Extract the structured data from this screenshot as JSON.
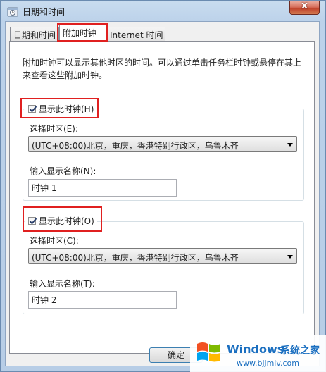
{
  "window": {
    "title": "日期和时间",
    "close_glyph": "x"
  },
  "tabs": [
    {
      "label": "日期和时间"
    },
    {
      "label": "附加时钟",
      "active": true
    },
    {
      "label": "Internet 时间"
    }
  ],
  "description": "附加时钟可以显示其他时区的时间。可以通过单击任务栏时钟或悬停在其上来查看这些附加时钟。",
  "clock1": {
    "checkbox_label": "显示此时钟(H)",
    "checked": true,
    "timezone_label": "选择时区(E):",
    "timezone_value": "(UTC+08:00)北京，重庆，香港特别行政区，乌鲁木齐",
    "name_label": "输入显示名称(N):",
    "name_value": "时钟 1"
  },
  "clock2": {
    "checkbox_label": "显示此时钟(O)",
    "checked": true,
    "timezone_label": "选择时区(C):",
    "timezone_value": "(UTC+08:00)北京，重庆，香港特别行政区，乌鲁木齐",
    "name_label": "输入显示名称(T):",
    "name_value": "时钟 2"
  },
  "buttons": {
    "ok": "确定"
  },
  "watermark": {
    "brand": "Windows",
    "cn": "系统之家",
    "url": "www.bjjmlv.com"
  },
  "colors": {
    "highlight": "#e02020",
    "watermark_blue": "#1b6fc0"
  }
}
